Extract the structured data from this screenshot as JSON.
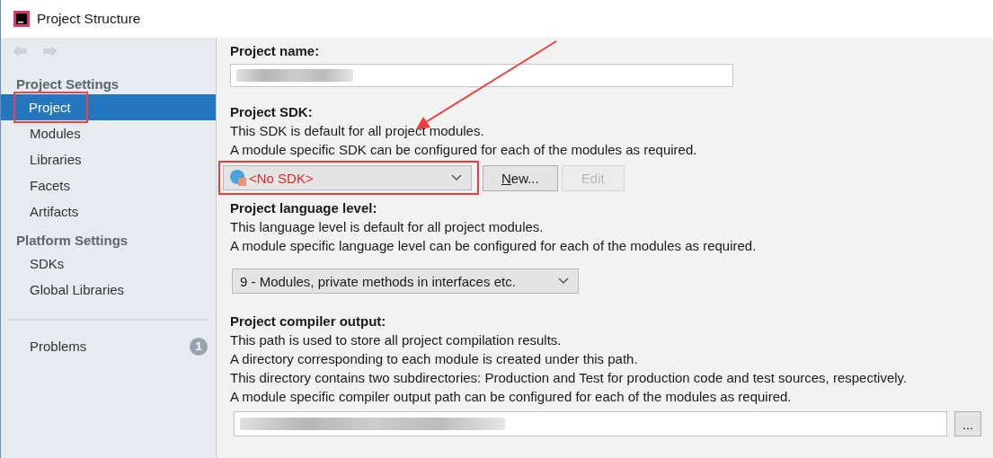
{
  "window": {
    "title": "Project Structure"
  },
  "sidebar": {
    "sections": [
      {
        "heading": "Project Settings",
        "items": [
          {
            "label": "Project",
            "selected": true
          },
          {
            "label": "Modules",
            "selected": false
          },
          {
            "label": "Libraries",
            "selected": false
          },
          {
            "label": "Facets",
            "selected": false
          },
          {
            "label": "Artifacts",
            "selected": false
          }
        ]
      },
      {
        "heading": "Platform Settings",
        "items": [
          {
            "label": "SDKs",
            "selected": false
          },
          {
            "label": "Global Libraries",
            "selected": false
          }
        ]
      }
    ],
    "problems": {
      "label": "Problems",
      "count": "1"
    }
  },
  "project_name": {
    "label": "Project name:"
  },
  "project_sdk": {
    "label": "Project SDK:",
    "description": [
      "This SDK is default for all project modules.",
      "A module specific SDK can be configured for each of the modules as required."
    ],
    "value": "<No SDK>",
    "buttons": [
      {
        "label": "New...",
        "disabled": false
      },
      {
        "label": "Edit",
        "disabled": true
      }
    ]
  },
  "language_level": {
    "label": "Project language level:",
    "description": [
      "This language level is default for all project modules.",
      "A module specific language level can be configured for each of the modules as required."
    ],
    "value": "9 - Modules, private methods in interfaces etc."
  },
  "compiler_output": {
    "label": "Project compiler output:",
    "description": [
      "This path is used to store all project compilation results.",
      "A directory corresponding to each module is created under this path.",
      "This directory contains two subdirectories: Production and Test for production code and test sources, respectively.",
      "A module specific compiler output path can be configured for each of the modules as required."
    ],
    "browse": "..."
  }
}
